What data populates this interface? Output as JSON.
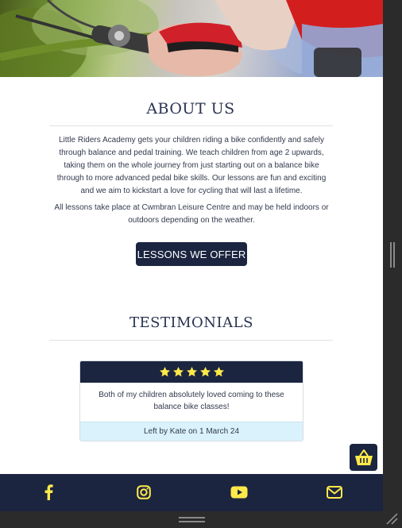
{
  "about": {
    "title": "ABOUT US",
    "paragraph1": "Little Riders Academy gets your children riding a bike confidently and safely through balance and pedal training. We teach children from age 2 upwards, taking them on the whole journey from just starting out on a balance bike through to more advanced pedal bike skills. Our lessons are fun and exciting and we aim to kickstart a love for cycling that will last a lifetime.",
    "paragraph2": "All lessons take place at Cwmbran Leisure Centre and may be held indoors or outdoors depending on the weather.",
    "button_label": "LESSONS WE OFFER"
  },
  "testimonials": {
    "title": "TESTIMONIALS",
    "rating": 5,
    "quote": "Both of my children absolutely loved coming to these balance bike classes!",
    "author": "Left by Kate on 1 March 24"
  },
  "basket": {
    "icon": "basket-icon"
  },
  "footer": {
    "icons": [
      "facebook-icon",
      "instagram-icon",
      "youtube-icon",
      "email-icon"
    ]
  },
  "colors": {
    "navy": "#1b2540",
    "accent_yellow": "#ffe94a",
    "author_bg": "#daf2fb"
  }
}
